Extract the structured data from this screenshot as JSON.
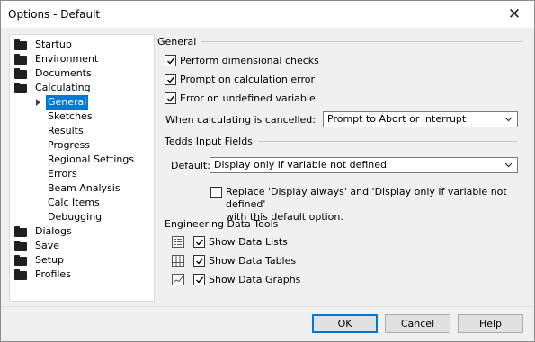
{
  "window": {
    "title": "Options - Default"
  },
  "tree": {
    "items": [
      {
        "label": "Startup"
      },
      {
        "label": "Environment"
      },
      {
        "label": "Documents"
      },
      {
        "label": "Calculating"
      }
    ],
    "calculating_children": [
      {
        "label": "General",
        "selected": true
      },
      {
        "label": "Sketches"
      },
      {
        "label": "Results"
      },
      {
        "label": "Progress"
      },
      {
        "label": "Regional Settings"
      },
      {
        "label": "Errors"
      },
      {
        "label": "Beam Analysis"
      },
      {
        "label": "Calc Items"
      },
      {
        "label": "Debugging"
      }
    ],
    "items_after": [
      {
        "label": "Dialogs"
      },
      {
        "label": "Save"
      },
      {
        "label": "Setup"
      },
      {
        "label": "Profiles"
      }
    ]
  },
  "general": {
    "header": "General",
    "checks": [
      {
        "label": "Perform dimensional checks",
        "checked": true
      },
      {
        "label": "Prompt on calculation error",
        "checked": true
      },
      {
        "label": "Error on undefined variable",
        "checked": true
      }
    ],
    "cancel_label": "When calculating is cancelled:",
    "cancel_value": "Prompt to Abort or Interrupt"
  },
  "tedds_input": {
    "header": "Tedds Input Fields",
    "default_label": "Default:",
    "default_value": "Display only if variable not defined",
    "replace_check": {
      "checked": false,
      "line1": "Replace 'Display always' and 'Display only if variable not defined'",
      "line2": "with this default option."
    }
  },
  "engineering": {
    "header": "Engineering Data Tools",
    "items": [
      {
        "label": "Show Data Lists",
        "icon": "data-list-icon",
        "checked": true
      },
      {
        "label": "Show Data Tables",
        "icon": "data-table-icon",
        "checked": true
      },
      {
        "label": "Show Data Graphs",
        "icon": "data-graph-icon",
        "checked": true
      }
    ]
  },
  "buttons": {
    "ok": "OK",
    "cancel": "Cancel",
    "help": "Help"
  },
  "colors": {
    "selection": "#0078d7",
    "accent_border": "#0078d7"
  }
}
